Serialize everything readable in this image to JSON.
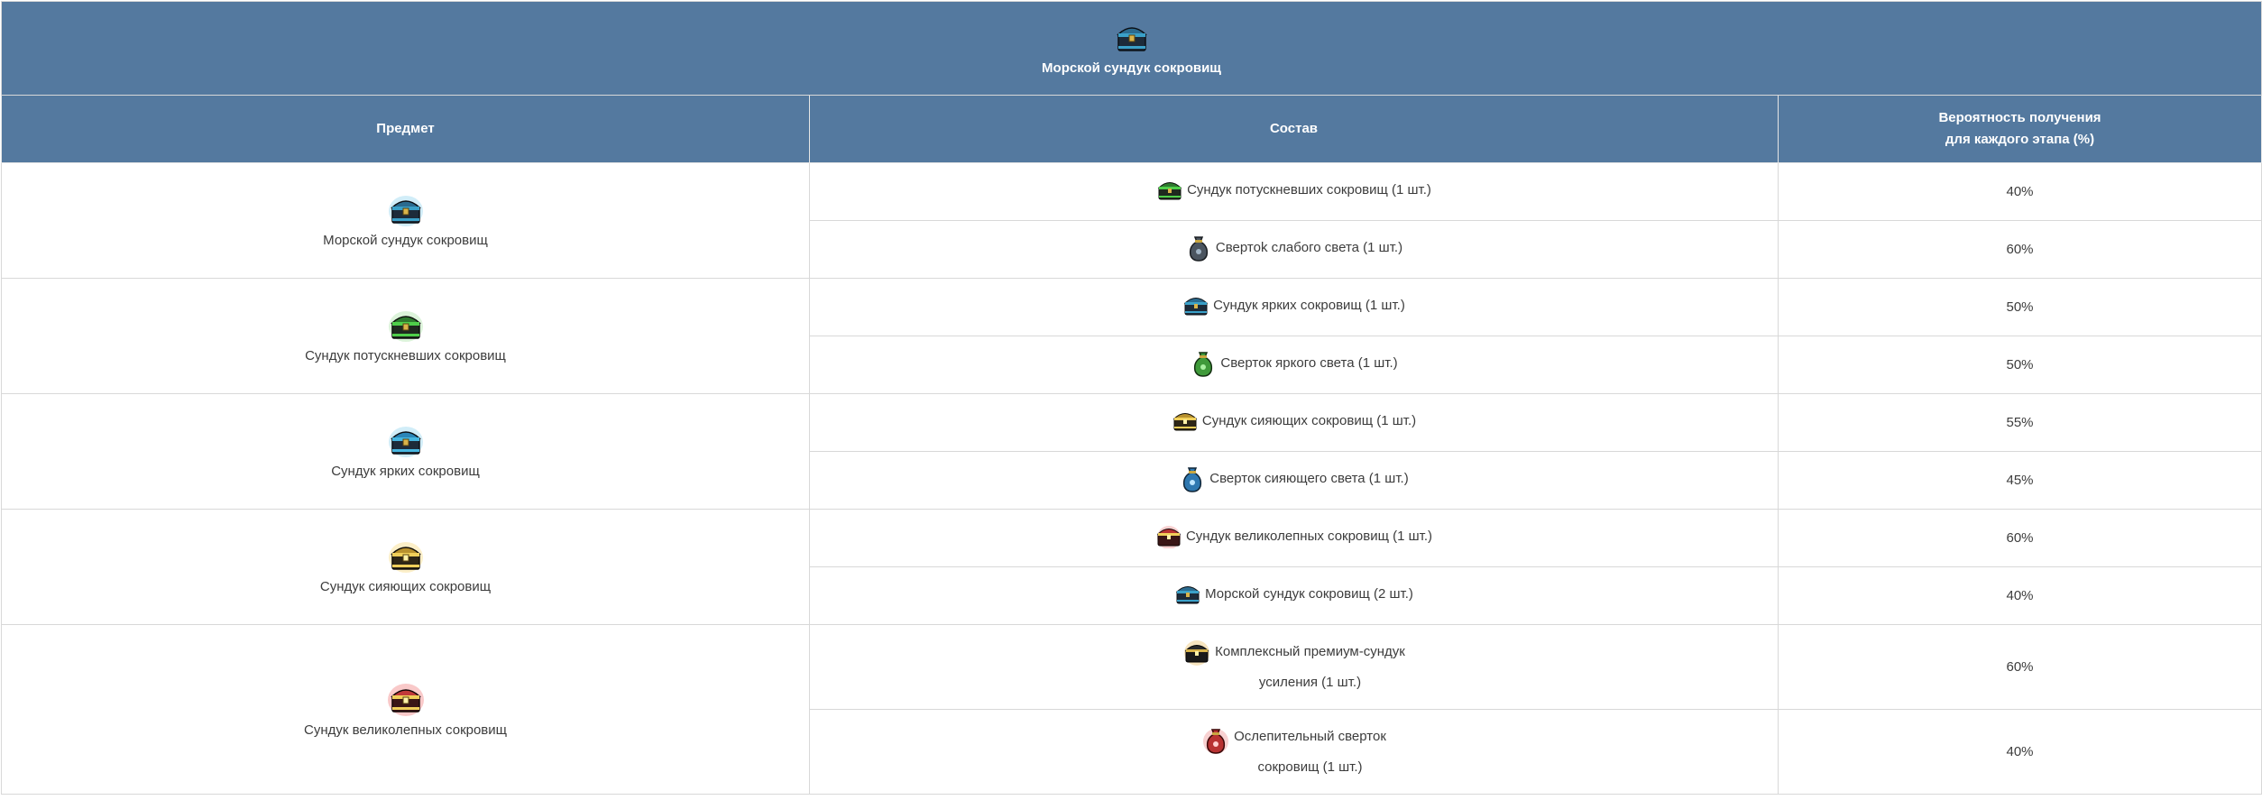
{
  "header": {
    "title": "Морской сундук сокровищ",
    "icon": "sea-chest-icon"
  },
  "columns": {
    "item": "Предмет",
    "composition": "Состав",
    "probability_line1": "Вероятность получения",
    "probability_line2": "для каждого этапа (%)"
  },
  "colors": {
    "header_bg": "#54799f",
    "header_text": "#ffffff",
    "border": "#d8d8d8"
  },
  "rows": [
    {
      "item": "Морской сундук сокровищ",
      "item_icon": "sea-chest-icon",
      "contents": [
        {
          "name": "Сундук потускневших сокровищ (1 шт.)",
          "icon": "green-chest-icon",
          "prob": "40%"
        },
        {
          "name": "Свертоk слабого света (1 шт.)",
          "icon": "gray-pouch-icon",
          "prob": "60%"
        }
      ]
    },
    {
      "item": "Сундук потускневших сокровищ",
      "item_icon": "green-chest-icon",
      "contents": [
        {
          "name": "Сундук ярких сокровищ (1 шт.)",
          "icon": "blue-chest-icon",
          "prob": "50%"
        },
        {
          "name": "Сверток яркого света (1 шт.)",
          "icon": "green-pouch-icon",
          "prob": "50%"
        }
      ]
    },
    {
      "item": "Сундук ярких сокровищ",
      "item_icon": "blue-chest-icon",
      "contents": [
        {
          "name": "Сундук сияющих сокровищ (1 шт.)",
          "icon": "gold-chest-icon",
          "prob": "55%"
        },
        {
          "name": "Сверток сияющего света (1 шт.)",
          "icon": "blue-pouch-icon",
          "prob": "45%"
        }
      ]
    },
    {
      "item": "Сундук сияющих сокровищ",
      "item_icon": "gold-chest-icon",
      "contents": [
        {
          "name": "Сундук великолепных сокровищ (1 шт.)",
          "icon": "red-chest-icon",
          "prob": "60%"
        },
        {
          "name": "Морской сундук сокровищ (2 шт.)",
          "icon": "sea-chest-icon",
          "prob": "40%"
        }
      ]
    },
    {
      "item": "Сундук великолепных сокровищ",
      "item_icon": "red-chest-icon",
      "contents": [
        {
          "name1": "Комплексный премиум-сундук",
          "name2": "усиления (1 шт.)",
          "icon": "premium-chest-icon",
          "prob": "60%"
        },
        {
          "name1": "Ослепительный сверток",
          "name2": "сокровищ (1 шт.)",
          "icon": "red-pouch-icon",
          "prob": "40%"
        }
      ]
    }
  ]
}
